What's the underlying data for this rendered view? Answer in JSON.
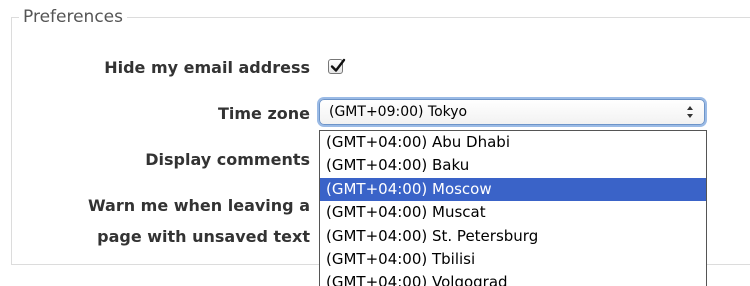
{
  "fieldset": {
    "legend": "Preferences"
  },
  "form": {
    "hide_email_label": "Hide my email address",
    "hide_email_checked": true,
    "time_zone_label": "Time zone",
    "display_comments_label": "Display comments",
    "warn_label_line1": "Warn me when leaving a",
    "warn_label_line2": "page with unsaved text"
  },
  "time_zone_select": {
    "selected_value": "(GMT+09:00) Tokyo",
    "arrows_icon": "up-down-arrows-icon"
  },
  "time_zone_dropdown": {
    "highlighted_index": 2,
    "options": [
      "(GMT+04:00) Abu Dhabi",
      "(GMT+04:00) Baku",
      "(GMT+04:00) Moscow",
      "(GMT+04:00) Muscat",
      "(GMT+04:00) St. Petersburg",
      "(GMT+04:00) Tbilisi",
      "(GMT+04:00) Volgograd"
    ]
  },
  "colors": {
    "highlight": "#3a63c8",
    "focus_ring": "#9bbbe6",
    "border": "#dcdcdc"
  }
}
